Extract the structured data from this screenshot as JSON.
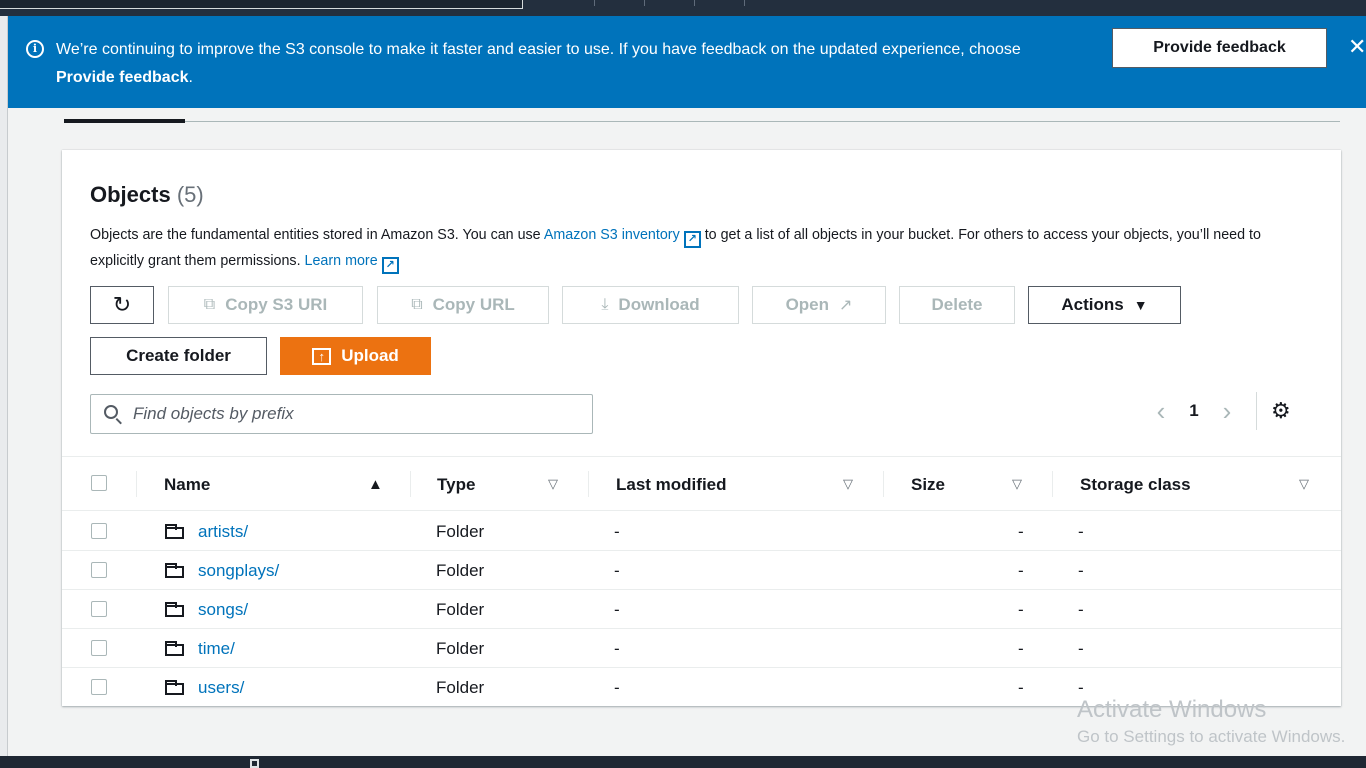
{
  "banner": {
    "message_pre": "We’re continuing to improve the S3 console to make it faster and easier to use. If you have feedback on the updated experience, choose ",
    "message_bold": "Provide feedback",
    "message_post": ".",
    "feedback_button": "Provide feedback",
    "close_glyph": "✕"
  },
  "objects": {
    "title": "Objects",
    "count": "(5)",
    "desc_1": "Objects are the fundamental entities stored in Amazon S3. You can use ",
    "desc_link_1": "Amazon S3 inventory",
    "desc_2": " to get a list of all objects in your bucket. For others to access your objects, you’ll need to explicitly grant them permissions. ",
    "desc_link_2": "Learn more"
  },
  "toolbar": {
    "refresh_glyph": "↻",
    "copy_s3_uri": "Copy S3 URI",
    "copy_url": "Copy URL",
    "download": "Download",
    "open": "Open",
    "delete": "Delete",
    "actions": "Actions",
    "create_folder": "Create folder",
    "upload": "Upload"
  },
  "search": {
    "placeholder": "Find objects by prefix",
    "value": ""
  },
  "pagination": {
    "prev": "‹",
    "page": "1",
    "next": "›",
    "settings_glyph": "⚙"
  },
  "table": {
    "headers": {
      "name": "Name",
      "type": "Type",
      "last_modified": "Last modified",
      "size": "Size",
      "storage_class": "Storage class"
    },
    "rows": [
      {
        "name": "artists/",
        "type": "Folder",
        "last_modified": "-",
        "size": "-",
        "storage_class": "-"
      },
      {
        "name": "songplays/",
        "type": "Folder",
        "last_modified": "-",
        "size": "-",
        "storage_class": "-"
      },
      {
        "name": "songs/",
        "type": "Folder",
        "last_modified": "-",
        "size": "-",
        "storage_class": "-"
      },
      {
        "name": "time/",
        "type": "Folder",
        "last_modified": "-",
        "size": "-",
        "storage_class": "-"
      },
      {
        "name": "users/",
        "type": "Folder",
        "last_modified": "-",
        "size": "-",
        "storage_class": "-"
      }
    ]
  },
  "watermark": {
    "line1": "Activate Windows",
    "line2": "Go to Settings to activate Windows."
  },
  "colors": {
    "banner_bg": "#0073bb",
    "primary_button": "#ec7211",
    "link": "#0073bb",
    "top_nav": "#232f3e"
  }
}
